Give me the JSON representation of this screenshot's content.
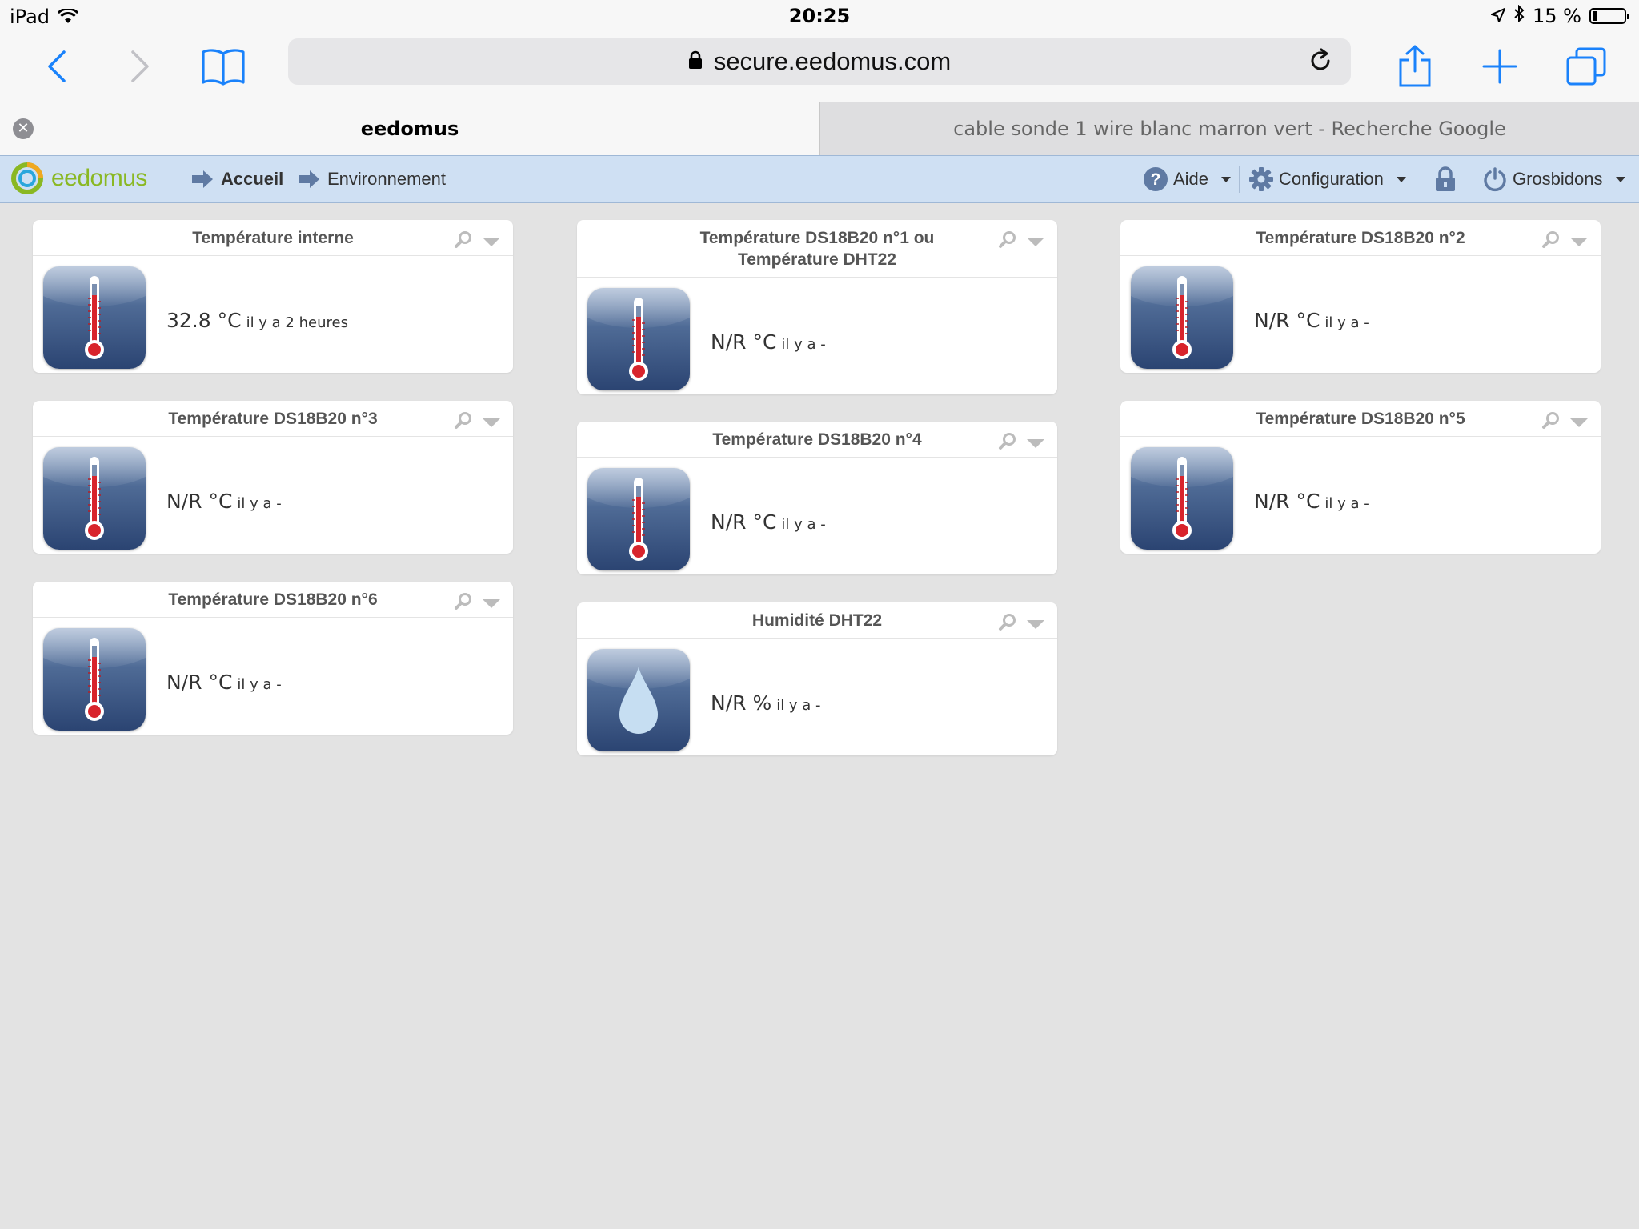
{
  "status_bar": {
    "device": "iPad",
    "time": "20:25",
    "battery": "15 %",
    "battery_level_percent": 15
  },
  "browser": {
    "url": "secure.eedomus.com",
    "tabs": [
      {
        "label": "eedomus",
        "active": true
      },
      {
        "label": "cable sonde 1 wire blanc marron vert - Recherche Google",
        "active": false
      }
    ]
  },
  "app": {
    "brand": "eedomus",
    "breadcrumbs": [
      "Accueil",
      "Environnement"
    ],
    "menu": {
      "help": "Aide",
      "config": "Configuration",
      "user": "Grosbidons"
    }
  },
  "widgets": [
    {
      "title": "Température interne",
      "value": "32.8 °C",
      "ago": "il y a 2 heures",
      "icon": "thermometer-icon"
    },
    {
      "title": "Température DS18B20 n°3",
      "value": "N/R °C",
      "ago": "il y a -",
      "icon": "thermometer-icon"
    },
    {
      "title": "Température DS18B20 n°6",
      "value": "N/R °C",
      "ago": "il y a -",
      "icon": "thermometer-icon"
    },
    {
      "title": "Température DS18B20 n°1 ou Température DHT22",
      "value": "N/R °C",
      "ago": "il y a -",
      "icon": "thermometer-icon"
    },
    {
      "title": "Température DS18B20 n°4",
      "value": "N/R °C",
      "ago": "il y a -",
      "icon": "thermometer-icon"
    },
    {
      "title": "Humidité DHT22",
      "value": "N/R %",
      "ago": "il y a -",
      "icon": "water-drop-icon"
    },
    {
      "title": "Température DS18B20 n°2",
      "value": "N/R °C",
      "ago": "il y a -",
      "icon": "thermometer-icon"
    },
    {
      "title": "Température DS18B20 n°5",
      "value": "N/R °C",
      "ago": "il y a -",
      "icon": "thermometer-icon"
    }
  ],
  "colors": {
    "ios_blue": "#1a82fb",
    "app_header": "#cfe0f3",
    "brand_green": "#8ab823",
    "icon_navy": "#2f4f7f",
    "mercury_red": "#d8242c"
  }
}
